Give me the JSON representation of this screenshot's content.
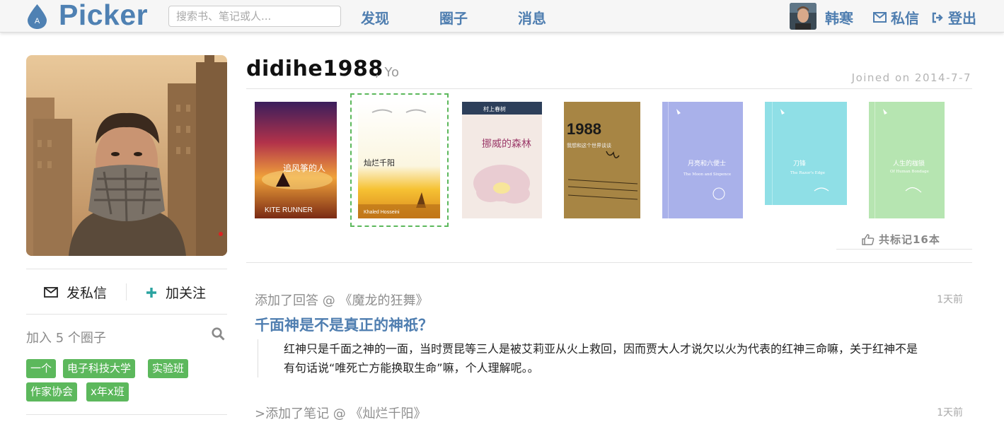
{
  "header": {
    "logo_letter": "A",
    "logo_text": "Picker",
    "search_placeholder": "搜索书、笔记或人...",
    "nav": [
      {
        "label": "发现"
      },
      {
        "label": "圈子"
      },
      {
        "label": "消息"
      }
    ],
    "user_name": "韩寒",
    "message_label": "私信",
    "logout_label": "登出",
    "accent_color": "#4f7eb0"
  },
  "profile": {
    "username": "didihe1988",
    "subtitle": ", Yo",
    "joined": "Joined on 2014-7-7",
    "message_button": "发私信",
    "follow_button": "加关注",
    "groups_title": "加入 5 个圈子",
    "groups": [
      "一个",
      "电子科技大学",
      "实验班",
      "作家协会",
      "x年x班"
    ]
  },
  "books": [
    {
      "title": "追风筝的人",
      "subtitle": "KITE RUNNER",
      "selected": false
    },
    {
      "title": "灿烂千阳",
      "subtitle": "Khaled Hosseini",
      "selected": true
    },
    {
      "title": "挪威的森林",
      "subtitle": "村上春树",
      "selected": false
    },
    {
      "title": "1988",
      "subtitle": "我想和这个世界谈谈",
      "selected": false
    },
    {
      "title": "月亮和六便士",
      "subtitle": "The Moon and Sixpence",
      "selected": false
    },
    {
      "title": "刀锋",
      "subtitle": "The Razor's Edge",
      "selected": false
    },
    {
      "title": "人生的枷锁",
      "subtitle": "Of Human Bondage",
      "selected": false
    }
  ],
  "marks_label": "共标记16本",
  "activities": [
    {
      "label": "添加了回答 @ 《魔龙的狂舞》",
      "time": "1天前",
      "question": "千面神是不是真正的神祇？",
      "quote_line1": "红神只是千面之神的一面，当时贾昆等三人是被艾莉亚从火上救回，因而贾大人才说欠以火为代表的红神三命嘛，关于红神不是",
      "quote_line2": "有句话说“唯死亡方能换取生命”嘛，个人理解呢。。"
    },
    {
      "label": ">添加了笔记 @ 《灿烂千阳》",
      "time": "1天前"
    }
  ]
}
